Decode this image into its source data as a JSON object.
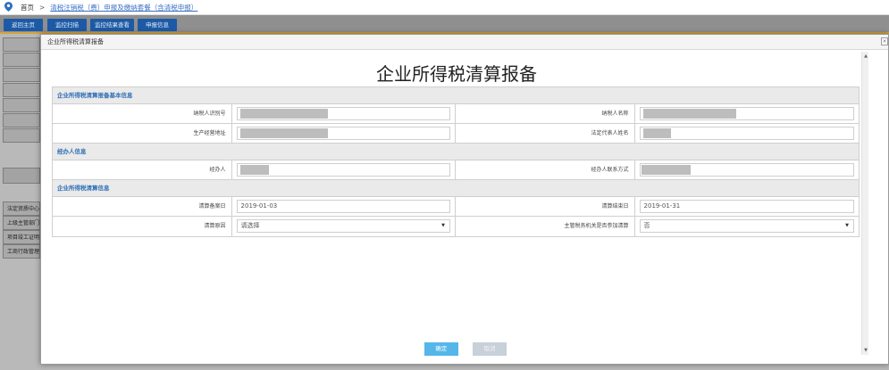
{
  "breadcrumb": {
    "home": "首页",
    "separator": ">",
    "current": "清税注销税（费）申报及缴纳套餐（含清税申报）"
  },
  "tabs": [
    "返回主页",
    "监控扫描",
    "监控结果查看",
    "申报信息"
  ],
  "background_labels": [
    "法定资质中心",
    "上级主管部门",
    "项目竣工证明",
    "工商行政管理"
  ],
  "modal": {
    "header": "企业所得税清算报备",
    "close": "×",
    "title": "企业所得税清算报备",
    "sections": {
      "basic": "企业所得税清算报备基本信息",
      "agent": "经办人信息",
      "liquidation": "企业所得税清算信息"
    },
    "fields": {
      "taxpayer_id_label": "纳税人识别号",
      "taxpayer_name_label": "纳税人名称",
      "address_label": "生产经营地址",
      "legal_rep_label": "法定代表人姓名",
      "agent_label": "经办人",
      "agent_contact_label": "经办人联系方式",
      "start_date_label": "清算备案日",
      "start_date_value": "2019-01-03",
      "end_date_label": "清算结束日",
      "end_date_value": "2019-01-31",
      "reason_label": "清算原因",
      "reason_value": "请选择",
      "tax_authority_label": "主管税务机关是否参加清算",
      "tax_authority_value": "否"
    },
    "buttons": {
      "ok": "确定",
      "cancel": "取消"
    }
  },
  "colors": {
    "accent": "#2f6fb5",
    "tab_bg": "#1d5aa6",
    "ok_button": "#55b6ea"
  },
  "icons": {
    "location": "location-pin-icon",
    "dropdown": "chevron-down-icon"
  }
}
